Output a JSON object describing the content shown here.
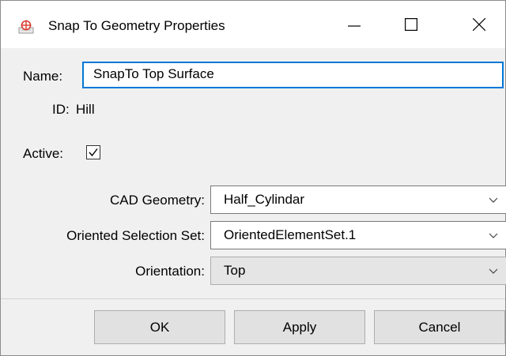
{
  "window": {
    "title": "Snap To Geometry Properties",
    "app_icon": "snap-geometry-icon",
    "controls": [
      "minimize-icon",
      "maximize-icon",
      "close-icon"
    ]
  },
  "form": {
    "name_label": "Name:",
    "name_value": "SnapTo Top Surface",
    "id_label": "ID:",
    "id_value": "Hill",
    "active_label": "Active:",
    "active_checked": true,
    "cad_geometry_label": "CAD Geometry:",
    "cad_geometry_value": "Half_Cylindar",
    "oriented_set_label": "Oriented Selection Set:",
    "oriented_set_value": "OrientedElementSet.1",
    "orientation_label": "Orientation:",
    "orientation_value": "Top"
  },
  "buttons": {
    "ok": "OK",
    "apply": "Apply",
    "cancel": "Cancel"
  },
  "colors": {
    "focus_border": "#0078d7",
    "dialog_background": "#f0f0f0",
    "icon_red": "#d83b2f"
  }
}
